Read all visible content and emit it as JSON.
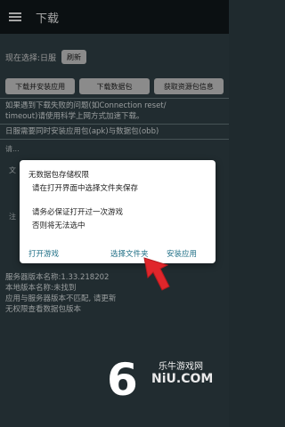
{
  "appbar": {
    "title": "下载"
  },
  "selection": {
    "label": "现在选择:日服",
    "refresh_label": "刷新"
  },
  "buttons": [
    "下载并安装应用",
    "下载数据包",
    "获取资源包信息"
  ],
  "info": [
    "如果遇到下载失败的问题(如Connection reset/",
    "timeout)请使用科学上网方式加速下载。",
    "日服需要同时安装应用包(apk)与数据包(obb)"
  ],
  "background_fragments": [
    "请...",
    "文",
    "注"
  ],
  "dialog": {
    "line1": "无数据包存储权限",
    "line2": "请在打开界面中选择文件夹保存",
    "line3": "请务必保证打开过一次游戏",
    "line4": "否则将无法选中",
    "btn_open_game": "打开游戏",
    "btn_select_folder": "选择文件夹",
    "btn_install": "安装应用"
  },
  "footer": [
    "服务器版本名称:1.33.218202",
    "本地版本名称:未找到",
    "应用与服务器版本不匹配, 请更新",
    "无权限查看数据包版本"
  ],
  "logo": {
    "digit": "6",
    "latin": "NiU.COM",
    "cn": "乐牛游戏网"
  },
  "colors": {
    "appbar": "#11191c",
    "content": "#33444a",
    "accent": "#1f6f86",
    "arrow": "#e0262b"
  }
}
